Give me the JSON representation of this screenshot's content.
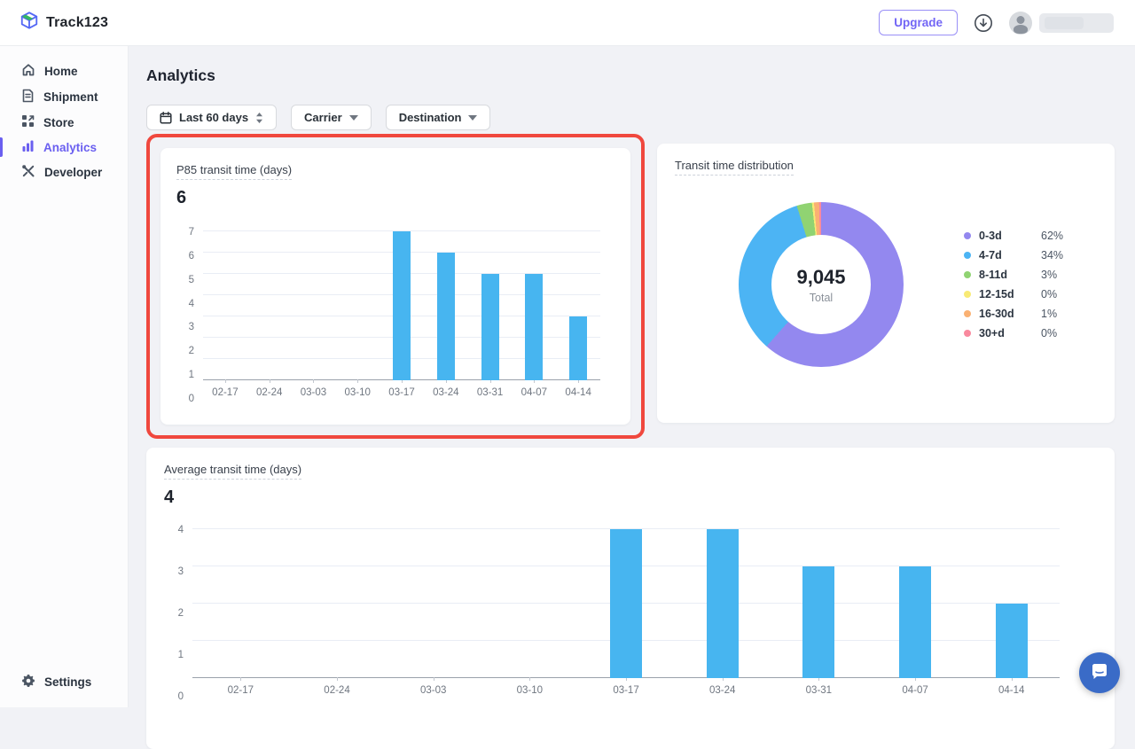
{
  "topbar": {
    "brand": "Track123",
    "upgrade_label": "Upgrade"
  },
  "sidebar": {
    "items": [
      {
        "label": "Home"
      },
      {
        "label": "Shipment"
      },
      {
        "label": "Store"
      },
      {
        "label": "Analytics"
      },
      {
        "label": "Developer"
      }
    ],
    "settings_label": "Settings"
  },
  "page": {
    "title": "Analytics"
  },
  "filters": {
    "date_range": "Last 60 days",
    "carrier": "Carrier",
    "destination": "Destination"
  },
  "chart_data": [
    {
      "type": "bar",
      "title": "P85 transit time (days)",
      "headline_value": "6",
      "categories": [
        "02-17",
        "02-24",
        "03-03",
        "03-10",
        "03-17",
        "03-24",
        "03-31",
        "04-07",
        "04-14"
      ],
      "values": [
        0,
        0,
        0,
        0,
        7,
        6,
        5,
        5,
        3
      ],
      "xlabel": "",
      "ylabel": "",
      "ylim": [
        0,
        7
      ],
      "yticks": [
        0,
        1,
        2,
        3,
        4,
        5,
        6,
        7
      ],
      "grid": true,
      "bar_color": "#47b5f0"
    },
    {
      "type": "pie",
      "title": "Transit time distribution",
      "center_value": "9,045",
      "center_label": "Total",
      "legend_position": "right",
      "slices": [
        {
          "label": "0-3d",
          "value": 62,
          "percent_label": "62%",
          "color": "#9388ef"
        },
        {
          "label": "4-7d",
          "value": 34,
          "percent_label": "34%",
          "color": "#4cb4f4"
        },
        {
          "label": "8-11d",
          "value": 3,
          "percent_label": "3%",
          "color": "#90d372"
        },
        {
          "label": "12-15d",
          "value": 0,
          "percent_label": "0%",
          "color": "#f8ea75"
        },
        {
          "label": "16-30d",
          "value": 1,
          "percent_label": "1%",
          "color": "#fab173"
        },
        {
          "label": "30+d",
          "value": 0,
          "percent_label": "0%",
          "color": "#f9899e"
        }
      ]
    },
    {
      "type": "bar",
      "title": "Average transit time (days)",
      "headline_value": "4",
      "categories": [
        "02-17",
        "02-24",
        "03-03",
        "03-10",
        "03-17",
        "03-24",
        "03-31",
        "04-07",
        "04-14"
      ],
      "values": [
        0,
        0,
        0,
        0,
        4,
        4,
        3,
        3,
        2
      ],
      "xlabel": "",
      "ylabel": "",
      "ylim": [
        0,
        4
      ],
      "yticks": [
        0,
        1,
        2,
        3,
        4
      ],
      "grid": true,
      "bar_color": "#47b5f0"
    }
  ]
}
